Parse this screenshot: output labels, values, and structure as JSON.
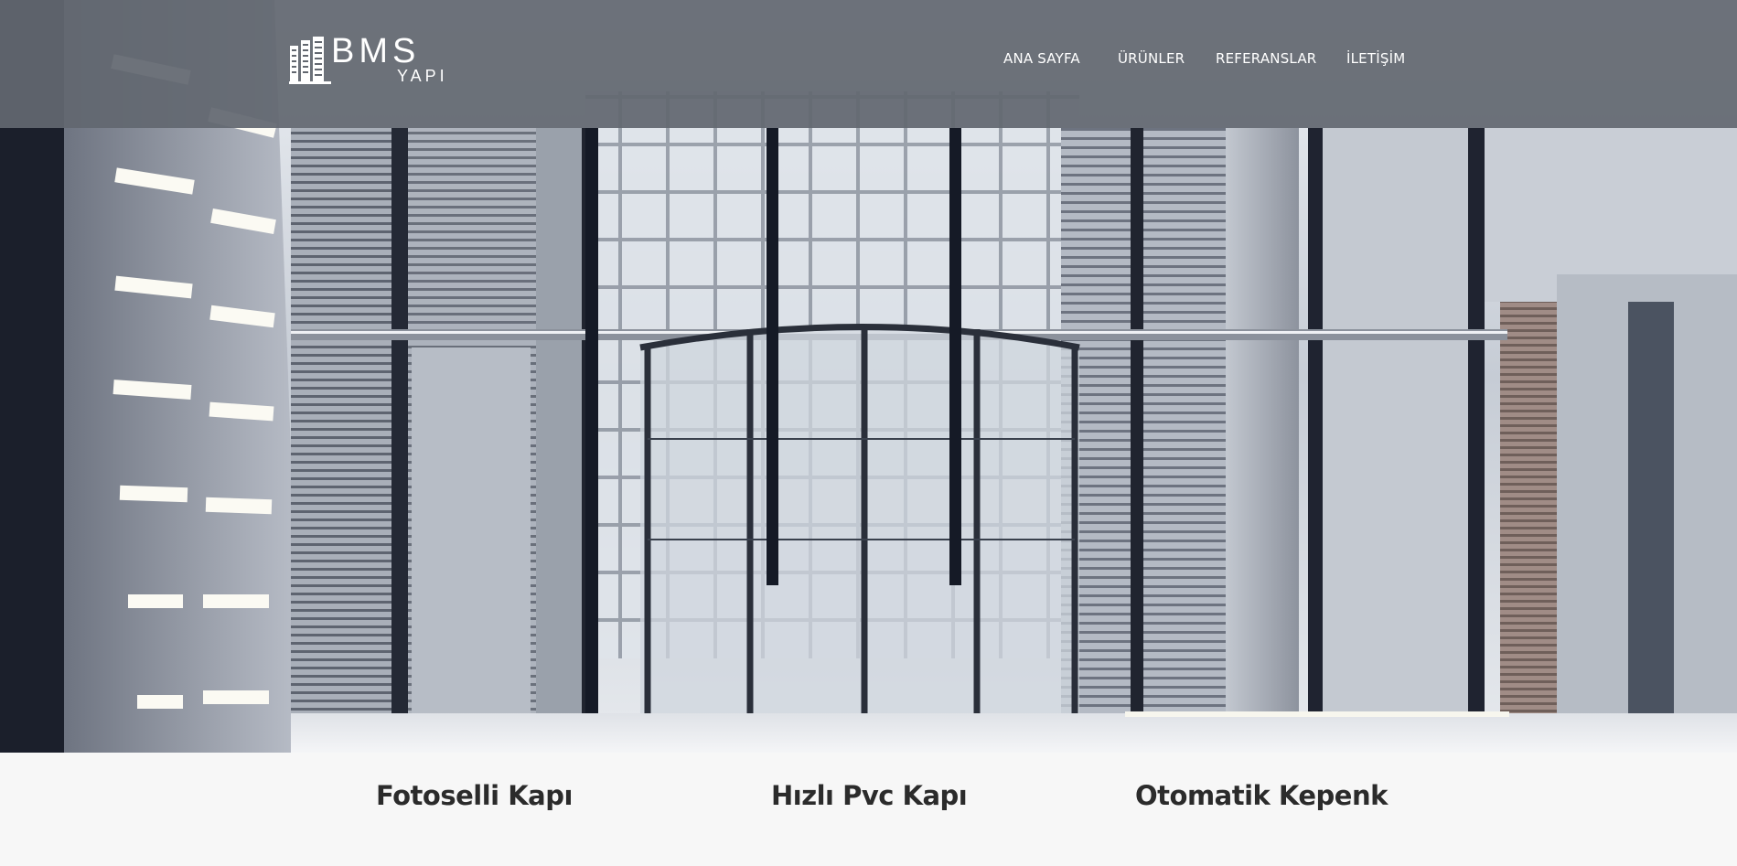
{
  "header": {
    "logo_text": "BMS",
    "logo_subtext": "YAPI",
    "nav": [
      {
        "label": "ANA SAYFA"
      },
      {
        "label": "ÜRÜNLER"
      },
      {
        "label": "REFERANSLAR"
      },
      {
        "label": "İLETİŞİM"
      }
    ]
  },
  "features": [
    {
      "title": "Fotoselli Kapı"
    },
    {
      "title": "Hızlı Pvc Kapı"
    },
    {
      "title": "Otomatik Kepenk"
    }
  ],
  "colors": {
    "header_bg": "#62676f",
    "nav_text": "#ffffff",
    "feature_text": "#2b2b2b",
    "page_bg": "#f7f7f7"
  }
}
